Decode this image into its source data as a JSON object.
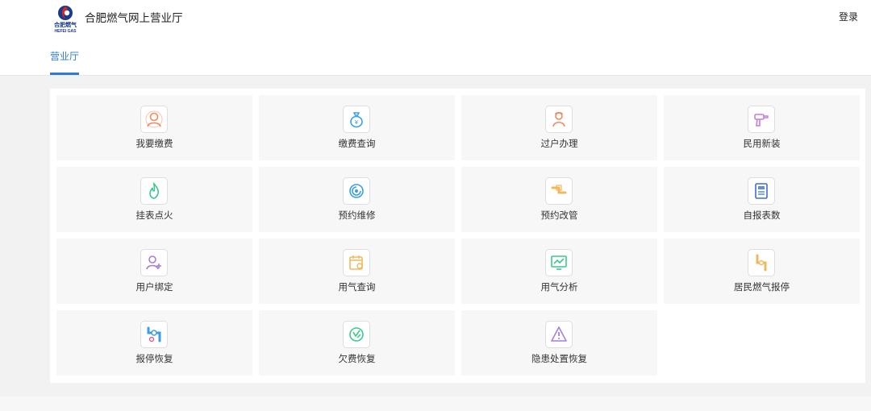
{
  "header": {
    "logo_text": "合肥燃气",
    "logo_subtext": "HEFEI GAS",
    "site_title": "合肥燃气网上营业厅",
    "login_label": "登录",
    "active_tab": "营业厅"
  },
  "colors": {
    "accent": "#2e7bd6",
    "logo_blue": "#1a3a8a",
    "logo_red": "#e02424"
  },
  "services": [
    {
      "label": "我要缴费",
      "icon": "payment-person-icon",
      "color": "#f08a5d"
    },
    {
      "label": "缴费查询",
      "icon": "money-bag-icon",
      "color": "#3b9fe0"
    },
    {
      "label": "过户办理",
      "icon": "transfer-person-icon",
      "color": "#f08a5d"
    },
    {
      "label": "民用新装",
      "icon": "drill-install-icon",
      "color": "#c77de0"
    },
    {
      "label": "挂表点火",
      "icon": "flame-icon",
      "color": "#3cc98a"
    },
    {
      "label": "预约维修",
      "icon": "repair-swirl-icon",
      "color": "#3b9fe0"
    },
    {
      "label": "预约改管",
      "icon": "pipe-change-icon",
      "color": "#f0b85d"
    },
    {
      "label": "自报表数",
      "icon": "meter-reading-icon",
      "color": "#3b6fd6"
    },
    {
      "label": "用户绑定",
      "icon": "user-bind-icon",
      "color": "#a87de0"
    },
    {
      "label": "用气查询",
      "icon": "calendar-query-icon",
      "color": "#f0b85d"
    },
    {
      "label": "用气分析",
      "icon": "chart-monitor-icon",
      "color": "#3cc98a"
    },
    {
      "label": "居民燃气报停",
      "icon": "gas-stop-pipe-icon",
      "color": "#f0b85d"
    },
    {
      "label": "报停恢复",
      "icon": "pipe-restore-icon",
      "color": "#3b9fe0"
    },
    {
      "label": "欠费恢复",
      "icon": "arrears-restore-icon",
      "color": "#3cc98a"
    },
    {
      "label": "隐患处置恢复",
      "icon": "hazard-warning-icon",
      "color": "#a87de0"
    }
  ]
}
